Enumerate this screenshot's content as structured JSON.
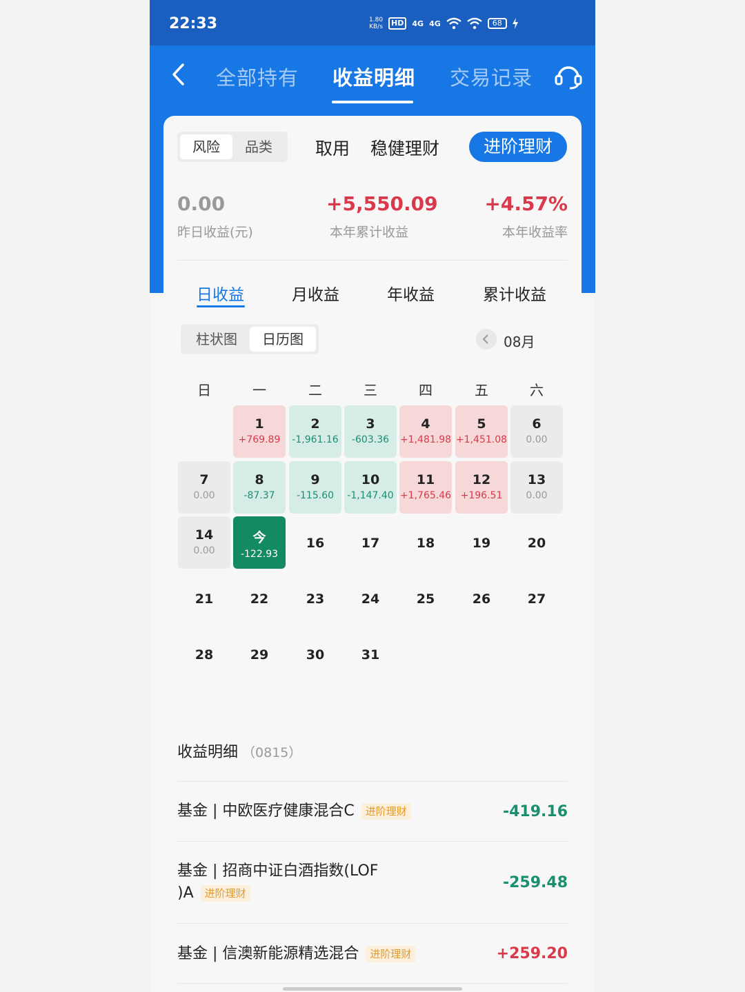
{
  "status_bar": {
    "time": "22:33",
    "net_speed": "1.80",
    "net_unit": "KB/s",
    "hd": "HD",
    "sig1": "4G",
    "sig2": "4G",
    "battery": "68"
  },
  "nav": {
    "tabs": [
      "全部持有",
      "收益明细",
      "交易记录"
    ],
    "active_tab": 1
  },
  "filter": {
    "segments": [
      "风险",
      "品类"
    ],
    "active_segment": 0,
    "categories": [
      "活取用",
      "稳健理财",
      "进阶理财"
    ],
    "active_category": 2,
    "partial_category": "取用"
  },
  "summary": {
    "yesterday": {
      "value": "0.00",
      "label": "昨日收益(元)"
    },
    "ytd": {
      "value": "+5,550.09",
      "label": "本年累计收益"
    },
    "rate": {
      "value": "+4.57%",
      "label": "本年收益率"
    }
  },
  "period_tabs": [
    "日收益",
    "月收益",
    "年收益",
    "累计收益"
  ],
  "active_period": 0,
  "view_toggle": {
    "options": [
      "柱状图",
      "日历图"
    ],
    "active": 1
  },
  "month": "08月",
  "weekdays": [
    "日",
    "一",
    "二",
    "三",
    "四",
    "五",
    "六"
  ],
  "calendar": [
    {
      "day": "1",
      "value": "+769.89",
      "type": "pos"
    },
    {
      "day": "2",
      "value": "-1,961.16",
      "type": "neg"
    },
    {
      "day": "3",
      "value": "-603.36",
      "type": "neg"
    },
    {
      "day": "4",
      "value": "+1,481.98",
      "type": "pos"
    },
    {
      "day": "5",
      "value": "+1,451.08",
      "type": "pos"
    },
    {
      "day": "6",
      "value": "0.00",
      "type": "zero"
    },
    {
      "day": "7",
      "value": "0.00",
      "type": "zero"
    },
    {
      "day": "8",
      "value": "-87.37",
      "type": "neg"
    },
    {
      "day": "9",
      "value": "-115.60",
      "type": "neg"
    },
    {
      "day": "10",
      "value": "-1,147.40",
      "type": "neg"
    },
    {
      "day": "11",
      "value": "+1,765.46",
      "type": "pos"
    },
    {
      "day": "12",
      "value": "+196.51",
      "type": "pos"
    },
    {
      "day": "13",
      "value": "0.00",
      "type": "zero"
    },
    {
      "day": "14",
      "value": "0.00",
      "type": "zero"
    },
    {
      "day": "今",
      "value": "-122.93",
      "type": "today"
    },
    {
      "day": "16",
      "value": "",
      "type": "none"
    },
    {
      "day": "17",
      "value": "",
      "type": "none"
    },
    {
      "day": "18",
      "value": "",
      "type": "none"
    },
    {
      "day": "19",
      "value": "",
      "type": "none"
    },
    {
      "day": "20",
      "value": "",
      "type": "none"
    },
    {
      "day": "21",
      "value": "",
      "type": "none"
    },
    {
      "day": "22",
      "value": "",
      "type": "none"
    },
    {
      "day": "23",
      "value": "",
      "type": "none"
    },
    {
      "day": "24",
      "value": "",
      "type": "none"
    },
    {
      "day": "25",
      "value": "",
      "type": "none"
    },
    {
      "day": "26",
      "value": "",
      "type": "none"
    },
    {
      "day": "27",
      "value": "",
      "type": "none"
    },
    {
      "day": "28",
      "value": "",
      "type": "none"
    },
    {
      "day": "29",
      "value": "",
      "type": "none"
    },
    {
      "day": "30",
      "value": "",
      "type": "none"
    },
    {
      "day": "31",
      "value": "",
      "type": "none"
    }
  ],
  "details": {
    "title": "收益明细",
    "code": "（0815）",
    "items": [
      {
        "name": "基金 | 中欧医疗健康混合C",
        "badge": "进阶理财",
        "value": "-419.16",
        "dir": "down"
      },
      {
        "name_line1": "基金 | 招商中证白酒指数(LOF",
        "name_line2": ")A",
        "badge": "进阶理财",
        "value": "-259.48",
        "dir": "down"
      },
      {
        "name": "基金 | 信澳新能源精选混合",
        "badge": "进阶理财",
        "value": "+259.20",
        "dir": "up"
      }
    ]
  },
  "colors": {
    "brand": "#1677e5",
    "up": "#d9394a",
    "down": "#1a8f6e",
    "today": "#138a62"
  }
}
